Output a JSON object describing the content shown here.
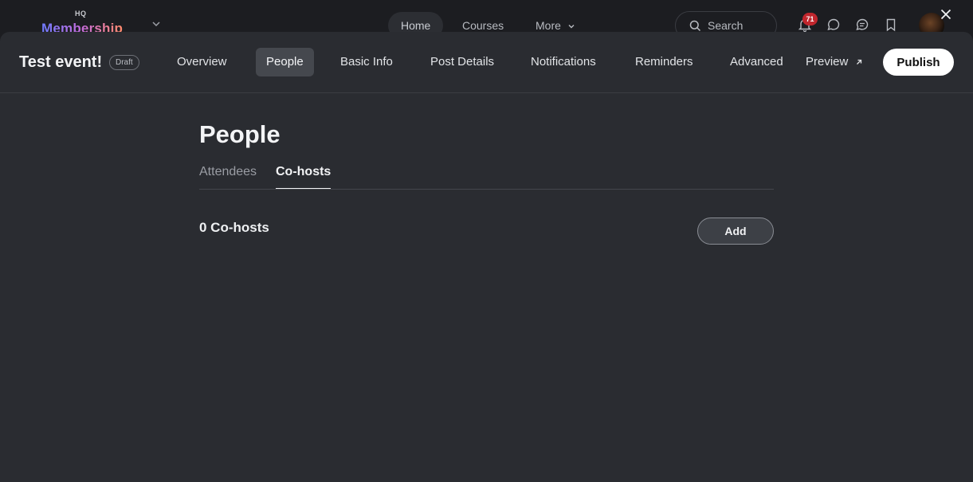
{
  "app": {
    "logo_top": "HQ",
    "logo_text": "Membership",
    "nav": {
      "home": "Home",
      "courses": "Courses",
      "more": "More"
    },
    "search_placeholder": "Search",
    "notification_count": "71",
    "icons": [
      "bell-icon",
      "chat-bubble-icon",
      "messages-icon",
      "bookmark-icon",
      "close-icon"
    ]
  },
  "event": {
    "title": "Test event!",
    "status": "Draft",
    "nav": {
      "overview": "Overview",
      "people": "People",
      "basic_info": "Basic Info",
      "post_details": "Post Details",
      "notifications": "Notifications",
      "reminders": "Reminders",
      "advanced": "Advanced",
      "preview": "Preview"
    },
    "active_nav": "People",
    "publish_label": "Publish"
  },
  "people": {
    "title": "People",
    "tabs": {
      "attendees": "Attendees",
      "cohosts": "Co-hosts"
    },
    "active_tab": "Co-hosts",
    "count_label": "0 Co-hosts",
    "add_label": "Add"
  },
  "colors": {
    "sheet_bg": "#2a2c31",
    "topbar_bg": "#1c1d21",
    "badge": "#c0262d",
    "active_nav_bg": "#45484e"
  }
}
